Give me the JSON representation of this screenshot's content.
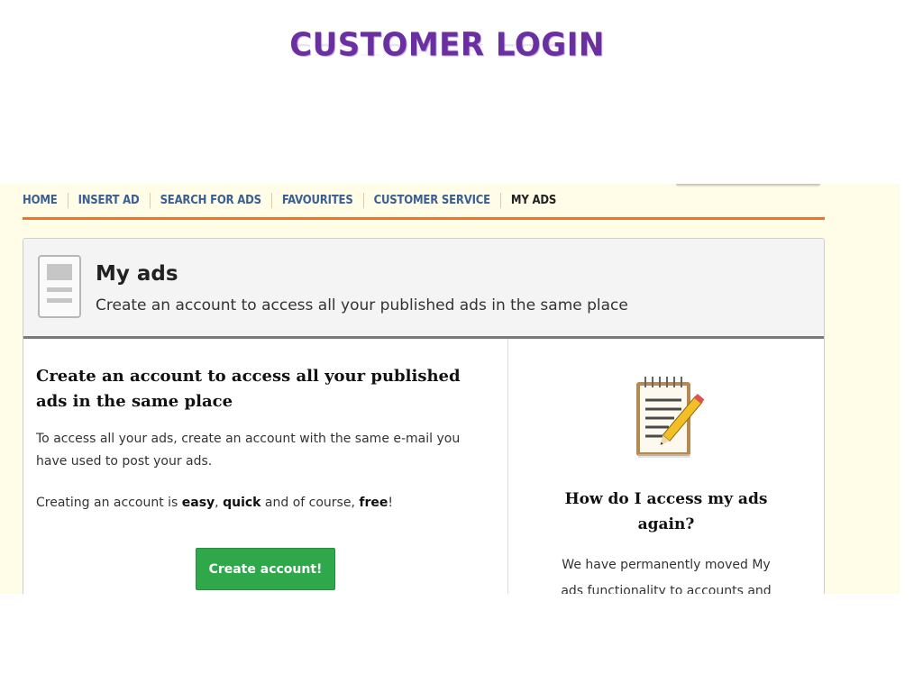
{
  "slide": {
    "title": "CUSTOMER LOGIN"
  },
  "nav": {
    "items": [
      {
        "label": "HOME"
      },
      {
        "label": "INSERT AD"
      },
      {
        "label": "SEARCH FOR ADS"
      },
      {
        "label": "FAVOURITES"
      },
      {
        "label": "CUSTOMER SERVICE"
      },
      {
        "label": "MY ADS",
        "active": true
      }
    ]
  },
  "header": {
    "title": "My ads",
    "subtitle": "Create an account to access all your published ads in the same place",
    "icon": "document-icon"
  },
  "left": {
    "heading": "Create an account to access all your published ads in the same place",
    "paragraph1": "To access all your ads, create an account with the same e-mail you have used to post your ads.",
    "p2_prefix": "Creating an account is ",
    "p2_easy": "easy",
    "p2_sep": ", ",
    "p2_quick": "quick",
    "p2_mid": " and of course, ",
    "p2_free": "free",
    "p2_end": "!",
    "button_label": "Create account!"
  },
  "right": {
    "icon": "notepad-pencil-icon",
    "heading": "How do I access my ads again?",
    "paragraph": "We have permanently moved My ads functionality to accounts and"
  },
  "colors": {
    "title": "#6a2fa0",
    "nav_link": "#3a5f93",
    "nav_underline": "#e8762f",
    "button": "#2ea84a",
    "background": "#fffde8"
  }
}
